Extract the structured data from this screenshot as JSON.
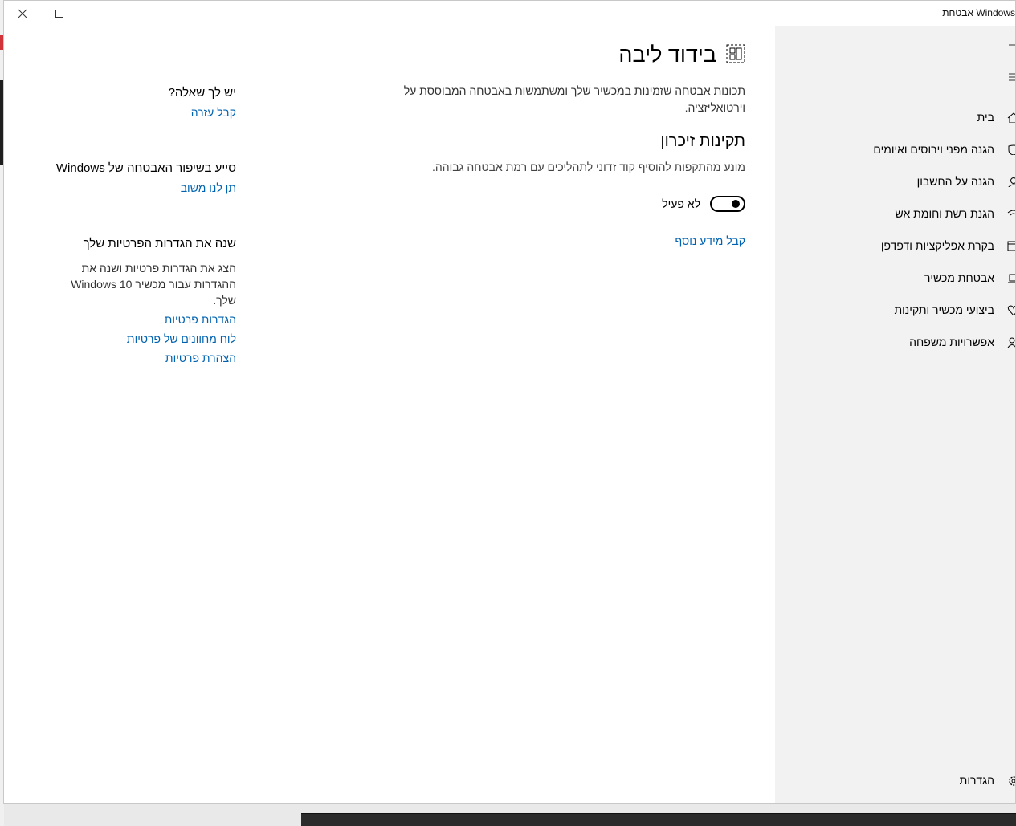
{
  "window": {
    "app_title": "אבטחת Windows",
    "close_label": "Close",
    "maximize_label": "Maximize",
    "minimize_label": "Minimize"
  },
  "sidebar": {
    "items": [
      {
        "label": "בית",
        "icon": "home-icon"
      },
      {
        "label": "הגנה מפני וירוסים ואיומים",
        "icon": "shield-icon"
      },
      {
        "label": "הגנה על החשבון",
        "icon": "person-icon"
      },
      {
        "label": "הגנת רשת וחומת אש",
        "icon": "wifi-icon"
      },
      {
        "label": "בקרת אפליקציות ודפדפן",
        "icon": "browser-icon"
      },
      {
        "label": "אבטחת מכשיר",
        "icon": "laptop-icon"
      },
      {
        "label": "ביצועי מכשיר ותקינות",
        "icon": "heart-icon"
      },
      {
        "label": "אפשרויות משפחה",
        "icon": "family-icon"
      }
    ],
    "settings_label": "הגדרות"
  },
  "main": {
    "title": "בידוד ליבה",
    "description": "תכונות אבטחה שזמינות במכשיר שלך ומשתמשות באבטחה המבוססת על וירטואליזציה.",
    "section_title": "תקינות זיכרון",
    "section_description": "מונע מהתקפות להוסיף קוד זדוני לתהליכים עם רמת אבטחה גבוהה.",
    "toggle_state_label": "לא פעיל",
    "toggle_on": false,
    "learn_more": "קבל מידע נוסף"
  },
  "aside": {
    "help_heading": "יש לך שאלה?",
    "help_link": "קבל עזרה",
    "feedback_heading": "סייע בשיפור האבטחה של Windows",
    "feedback_link": "תן לנו משוב",
    "privacy_heading": "שנה את הגדרות הפרטיות שלך",
    "privacy_text": "הצג את הגדרות פרטיות  ושנה את ההגדרות עבור מכשיר Windows 10 שלך.",
    "privacy_links": [
      "הגדרות פרטיות",
      "לוח מחוונים של פרטיות",
      "הצהרת פרטיות"
    ]
  },
  "colors": {
    "accent": "#0063b1",
    "sidebar_bg": "#f2f2f2"
  }
}
